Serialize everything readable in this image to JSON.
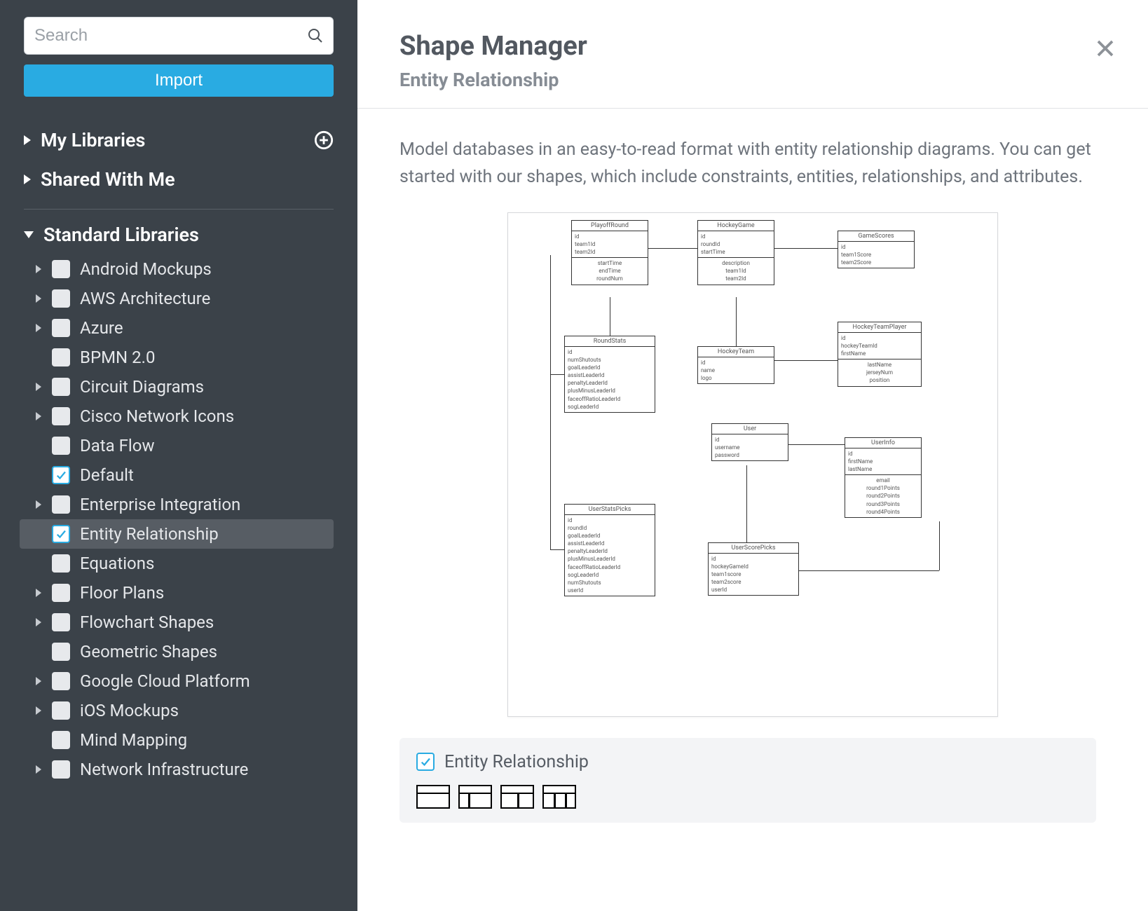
{
  "sidebar": {
    "search_placeholder": "Search",
    "import_label": "Import",
    "sections": {
      "my_libraries": "My Libraries",
      "shared_with_me": "Shared With Me",
      "standard_libraries": "Standard Libraries"
    },
    "libraries": [
      {
        "label": "Android Mockups",
        "expandable": true,
        "checked": false
      },
      {
        "label": "AWS Architecture",
        "expandable": true,
        "checked": false
      },
      {
        "label": "Azure",
        "expandable": true,
        "checked": false
      },
      {
        "label": "BPMN 2.0",
        "expandable": false,
        "checked": false
      },
      {
        "label": "Circuit Diagrams",
        "expandable": true,
        "checked": false
      },
      {
        "label": "Cisco Network Icons",
        "expandable": true,
        "checked": false
      },
      {
        "label": "Data Flow",
        "expandable": false,
        "checked": false
      },
      {
        "label": "Default",
        "expandable": false,
        "checked": true
      },
      {
        "label": "Enterprise Integration",
        "expandable": true,
        "checked": false
      },
      {
        "label": "Entity Relationship",
        "expandable": false,
        "checked": true,
        "selected": true
      },
      {
        "label": "Equations",
        "expandable": false,
        "checked": false
      },
      {
        "label": "Floor Plans",
        "expandable": true,
        "checked": false
      },
      {
        "label": "Flowchart Shapes",
        "expandable": true,
        "checked": false
      },
      {
        "label": "Geometric Shapes",
        "expandable": false,
        "checked": false
      },
      {
        "label": "Google Cloud Platform",
        "expandable": true,
        "checked": false
      },
      {
        "label": "iOS Mockups",
        "expandable": true,
        "checked": false
      },
      {
        "label": "Mind Mapping",
        "expandable": false,
        "checked": false
      },
      {
        "label": "Network Infrastructure",
        "expandable": true,
        "checked": false
      }
    ]
  },
  "main": {
    "title": "Shape Manager",
    "subtitle": "Entity Relationship",
    "description": "Model databases in an easy-to-read format with entity relationship diagrams. You can get started with our shapes, which include constraints, entities, relationships, and attributes.",
    "card_label": "Entity Relationship"
  },
  "diagram": {
    "entities": [
      {
        "name": "PlayoffRound",
        "header_fields": [
          "id",
          "team1Id",
          "team2Id"
        ],
        "body_fields": [
          "startTime",
          "endTime",
          "roundNum"
        ]
      },
      {
        "name": "HockeyGame",
        "header_fields": [
          "id",
          "roundId",
          "startTime"
        ],
        "body_fields": [
          "description",
          "team1Id",
          "team2Id"
        ]
      },
      {
        "name": "GameScores",
        "header_fields": [
          "id",
          "team1Score",
          "team2Score"
        ],
        "body_fields": []
      },
      {
        "name": "HockeyTeam",
        "header_fields": [
          "id",
          "name",
          "logo"
        ],
        "body_fields": []
      },
      {
        "name": "RoundStats",
        "header_fields": [
          "id",
          "numShutouts",
          "goalLeaderId",
          "assistLeaderId",
          "penaltyLeaderId",
          "plusMinusLeaderId",
          "faceoffRatioLeaderId",
          "sogLeaderId"
        ],
        "body_fields": []
      },
      {
        "name": "HockeyTeamPlayer",
        "header_fields": [
          "id",
          "hockeyTeamId",
          "firstName"
        ],
        "body_fields": [
          "lastName",
          "jerseyNum",
          "position"
        ]
      },
      {
        "name": "User",
        "header_fields": [
          "id",
          "username",
          "password"
        ],
        "body_fields": []
      },
      {
        "name": "UserInfo",
        "header_fields": [
          "id",
          "firstName",
          "lastName"
        ],
        "body_fields": [
          "email",
          "round1Points",
          "round2Points",
          "round3Points",
          "round4Points"
        ]
      },
      {
        "name": "UserStatsPicks",
        "header_fields": [
          "id",
          "roundId",
          "goalLeaderId",
          "assistLeaderId",
          "penaltyLeaderId",
          "plusMinusLeaderId",
          "faceoffRatioLeaderId",
          "sogLeaderId",
          "numShutouts",
          "userId"
        ],
        "body_fields": []
      },
      {
        "name": "UserScorePicks",
        "header_fields": [
          "id",
          "hockeyGameId",
          "team1score",
          "team2score",
          "userId"
        ],
        "body_fields": []
      }
    ]
  }
}
